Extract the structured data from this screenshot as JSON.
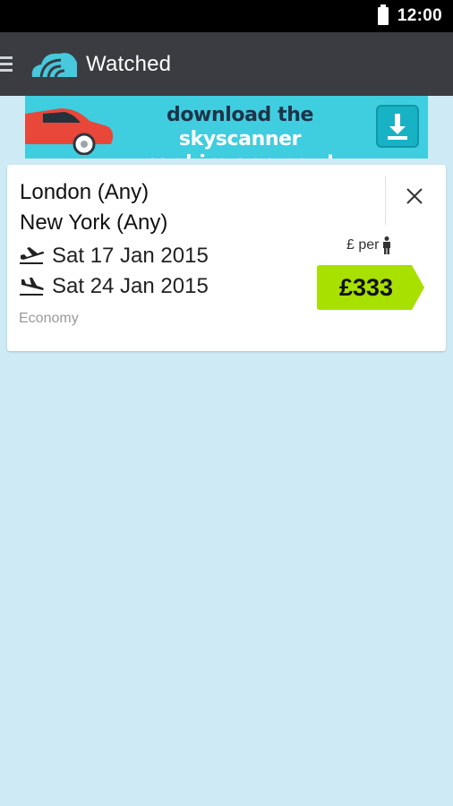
{
  "status_bar": {
    "time": "12:00"
  },
  "app_bar": {
    "title": "Watched"
  },
  "banner": {
    "line1_prefix": "download the ",
    "line1_brand": "skyscanner",
    "line2": "car hire app now!"
  },
  "watched": [
    {
      "origin": "London (Any)",
      "destination": "New York (Any)",
      "outbound": "Sat 17 Jan 2015",
      "inbound": "Sat 24 Jan 2015",
      "cabin": "Economy",
      "price_caption": "£ per",
      "price": "£333"
    }
  ],
  "colors": {
    "app_bar": "#3a3c41",
    "background": "#cdeaf5",
    "price_tag": "#a8e000",
    "brand_cyan": "#3fcde0"
  },
  "icons": [
    "menu-icon",
    "skyscanner-logo",
    "car-icon",
    "download-icon",
    "takeoff-icon",
    "landing-icon",
    "close-icon",
    "person-icon",
    "battery-icon"
  ]
}
